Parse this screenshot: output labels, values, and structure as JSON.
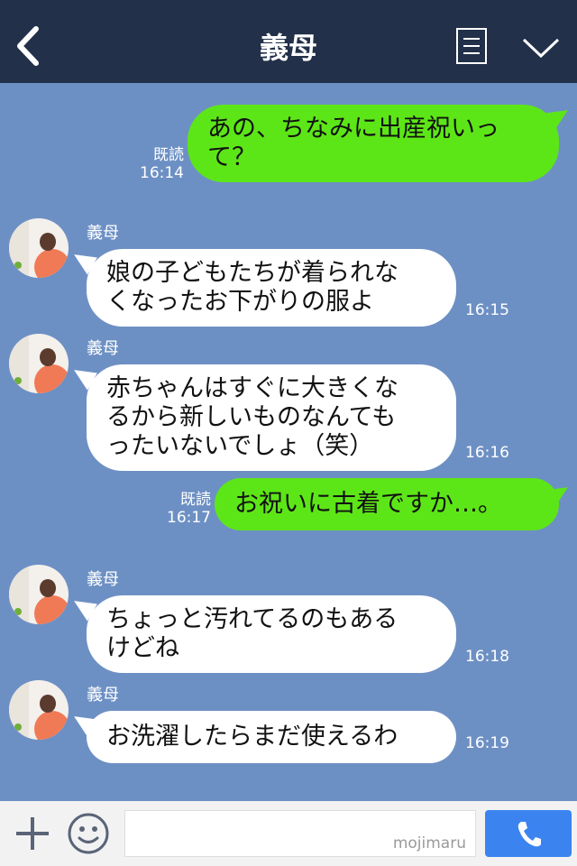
{
  "header": {
    "title": "義母",
    "back_icon": "chevron-left-icon",
    "menu_icon": "list-icon",
    "dropdown_icon": "chevron-down-icon"
  },
  "messages": [
    {
      "side": "right",
      "text_lines": [
        "あの、ちなみに出産祝いっ",
        "て？"
      ],
      "read": "既読",
      "time": "16:14"
    },
    {
      "side": "left",
      "sender": "義母",
      "text_lines": [
        "娘の子どもたちが着られな",
        "くなったお下がりの服よ"
      ],
      "time": "16:15"
    },
    {
      "side": "left",
      "sender": "義母",
      "text_lines": [
        "赤ちゃんはすぐに大きくな",
        "るから新しいものなんても",
        "ったいないでしょ（笑）"
      ],
      "time": "16:16"
    },
    {
      "side": "right",
      "text_lines": [
        "お祝いに古着ですか…。"
      ],
      "read": "既読",
      "time": "16:17"
    },
    {
      "side": "left",
      "sender": "義母",
      "text_lines": [
        "ちょっと汚れてるのもある",
        "けどね"
      ],
      "time": "16:18"
    },
    {
      "side": "left",
      "sender": "義母",
      "text_lines": [
        "お洗濯したらまだ使えるわ"
      ],
      "time": "16:19"
    }
  ],
  "footer": {
    "plus_icon": "plus-icon",
    "emoji_icon": "smiley-icon",
    "input_value": "",
    "watermark": "mojimaru",
    "call_icon": "phone-icon"
  },
  "colors": {
    "header_bg": "#223049",
    "chat_bg": "#6d90c4",
    "bubble_green": "#5de617",
    "bubble_white": "#ffffff",
    "call_button": "#3b84f0"
  }
}
